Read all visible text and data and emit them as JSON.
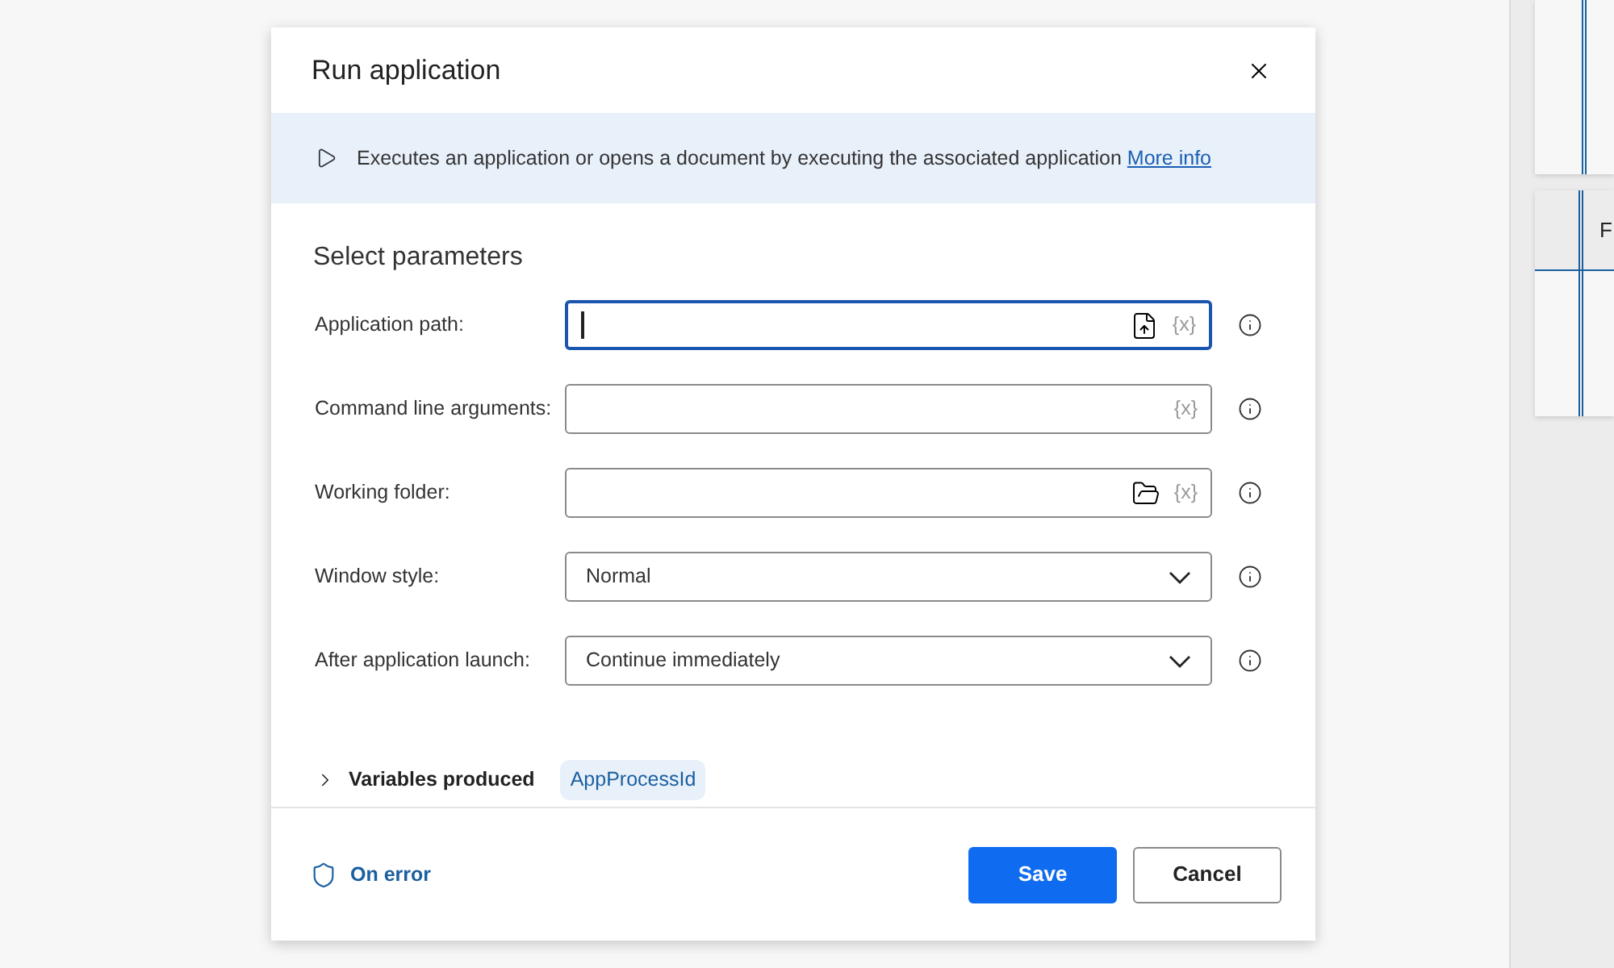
{
  "dialog": {
    "title": "Run application",
    "description": "Executes an application or opens a document by executing the associated application",
    "more_info": "More info",
    "section_title": "Select parameters",
    "fields": [
      {
        "kind": "file",
        "label": "Application path:",
        "variable": "{x}",
        "focused": true
      },
      {
        "kind": "text",
        "label": "Command line arguments:",
        "variable": "{x}",
        "focused": false
      },
      {
        "kind": "folder",
        "label": "Working folder:",
        "variable": "{x}",
        "focused": false
      },
      {
        "kind": "dropdown",
        "label": "Window style:",
        "value": "Normal",
        "focused": false
      },
      {
        "kind": "dropdown",
        "label": "After application launch:",
        "value": "Continue immediately",
        "focused": false
      }
    ],
    "variables": {
      "label": "Variables produced",
      "expanded": false,
      "items": [
        "AppProcessId"
      ]
    },
    "on_error": "On error",
    "buttons": [
      {
        "label": "Save",
        "primary": true
      },
      {
        "label": "Cancel",
        "primary": false
      }
    ]
  },
  "background": {
    "card_text": "F"
  }
}
